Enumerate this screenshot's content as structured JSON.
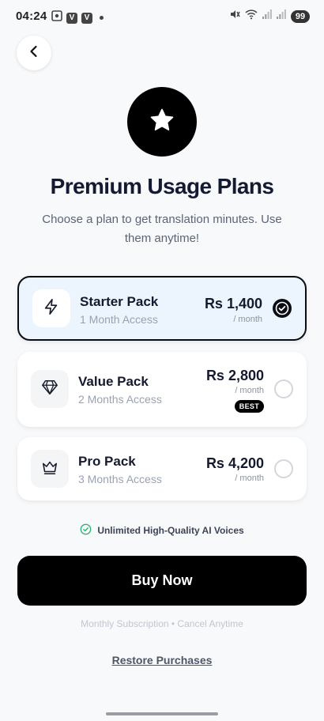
{
  "status_bar": {
    "time": "04:24",
    "left_icons": [
      "screenshot-icon",
      "v-app-icon",
      "v-app-icon",
      "dot-icon"
    ],
    "right_icons": [
      "mute-icon",
      "wifi-icon",
      "signal-icon",
      "signal-icon"
    ],
    "battery": "99"
  },
  "header": {
    "back_icon": "chevron-left-icon"
  },
  "hero": {
    "icon": "star-icon",
    "title": "Premium Usage Plans",
    "subtitle": "Choose a plan to get translation minutes. Use them anytime!"
  },
  "plans": [
    {
      "icon": "lightning-icon",
      "name": "Starter Pack",
      "duration": "1 Month Access",
      "price": "Rs 1,400",
      "period": "/ month",
      "badge": "",
      "selected": true
    },
    {
      "icon": "diamond-icon",
      "name": "Value Pack",
      "duration": "2 Months Access",
      "price": "Rs 2,800",
      "period": "/ month",
      "badge": "BEST",
      "selected": false
    },
    {
      "icon": "crown-icon",
      "name": "Pro Pack",
      "duration": "3 Months Access",
      "price": "Rs 4,200",
      "period": "/ month",
      "badge": "",
      "selected": false
    }
  ],
  "feature": {
    "icon": "check-circle-icon",
    "text": "Unlimited High-Quality AI Voices"
  },
  "buy_button": "Buy Now",
  "subscription_note": "Monthly Subscription • Cancel Anytime",
  "restore_link": "Restore Purchases",
  "colors": {
    "accent": "#000000",
    "selected_bg": "#ecf4fe",
    "feature_check": "#2bb673"
  }
}
